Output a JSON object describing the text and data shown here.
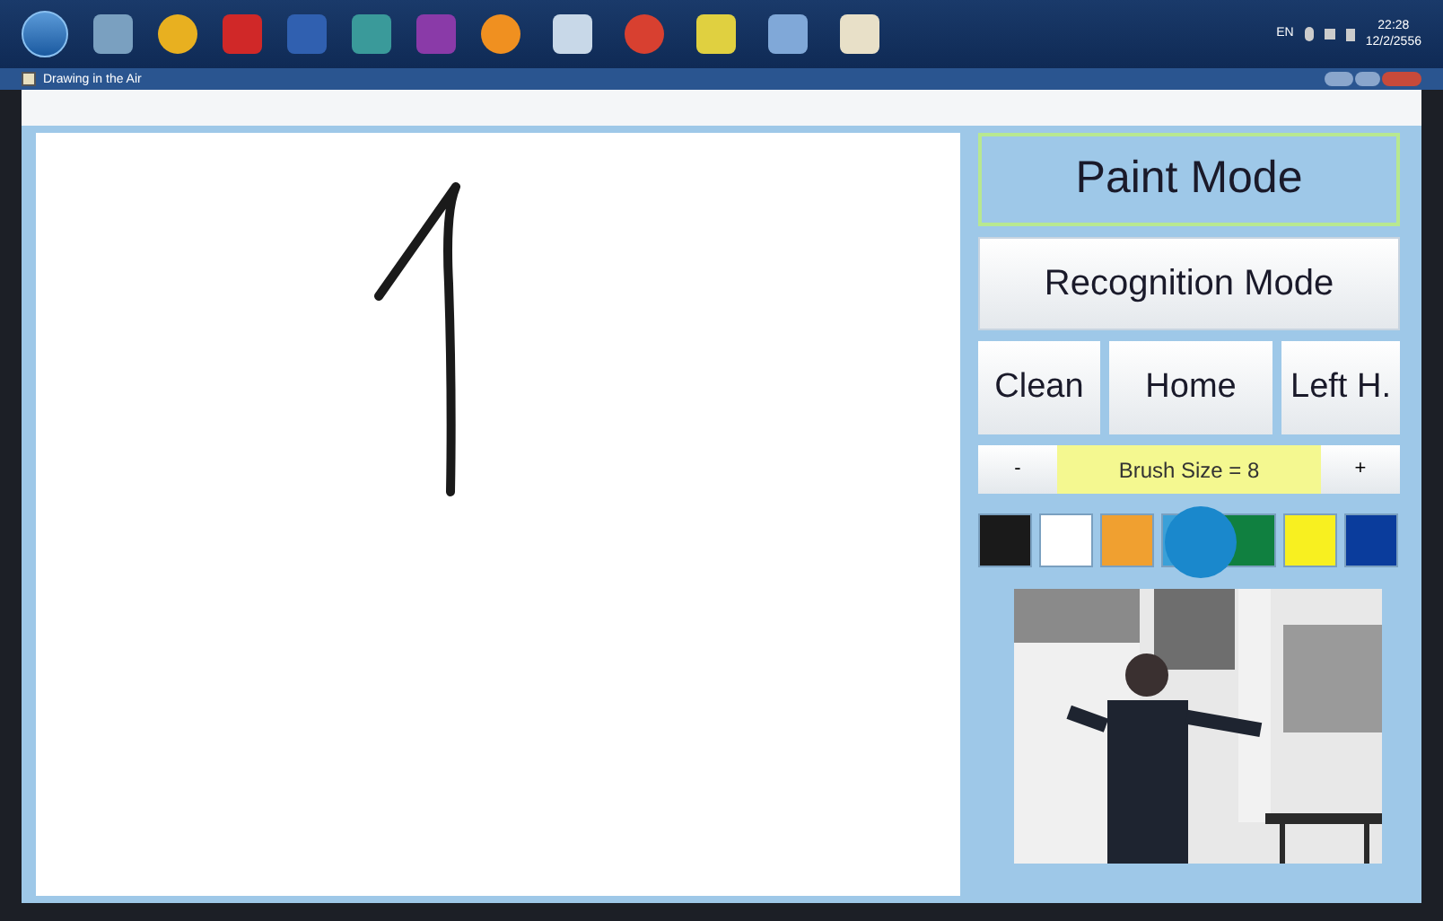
{
  "taskbar": {
    "tray": {
      "language": "EN",
      "time": "22:28",
      "date": "12/2/2556"
    }
  },
  "window": {
    "title": "Drawing in the Air"
  },
  "modes": [
    {
      "label": "Paint Mode",
      "selected": true
    },
    {
      "label": "Recognition Mode",
      "selected": false
    }
  ],
  "actions": [
    "Clean",
    "Home",
    "Left H."
  ],
  "brush": {
    "minus": "-",
    "label": "Brush Size = 8",
    "plus": "+"
  },
  "swatches": [
    {
      "color": "#1a1a1a"
    },
    {
      "color": "#ffffff"
    },
    {
      "color": "#f0a030"
    },
    {
      "color": "#3aa0d8"
    },
    {
      "color": "#108040"
    },
    {
      "color": "#f8f020"
    },
    {
      "color": "#0a3c9c"
    }
  ]
}
